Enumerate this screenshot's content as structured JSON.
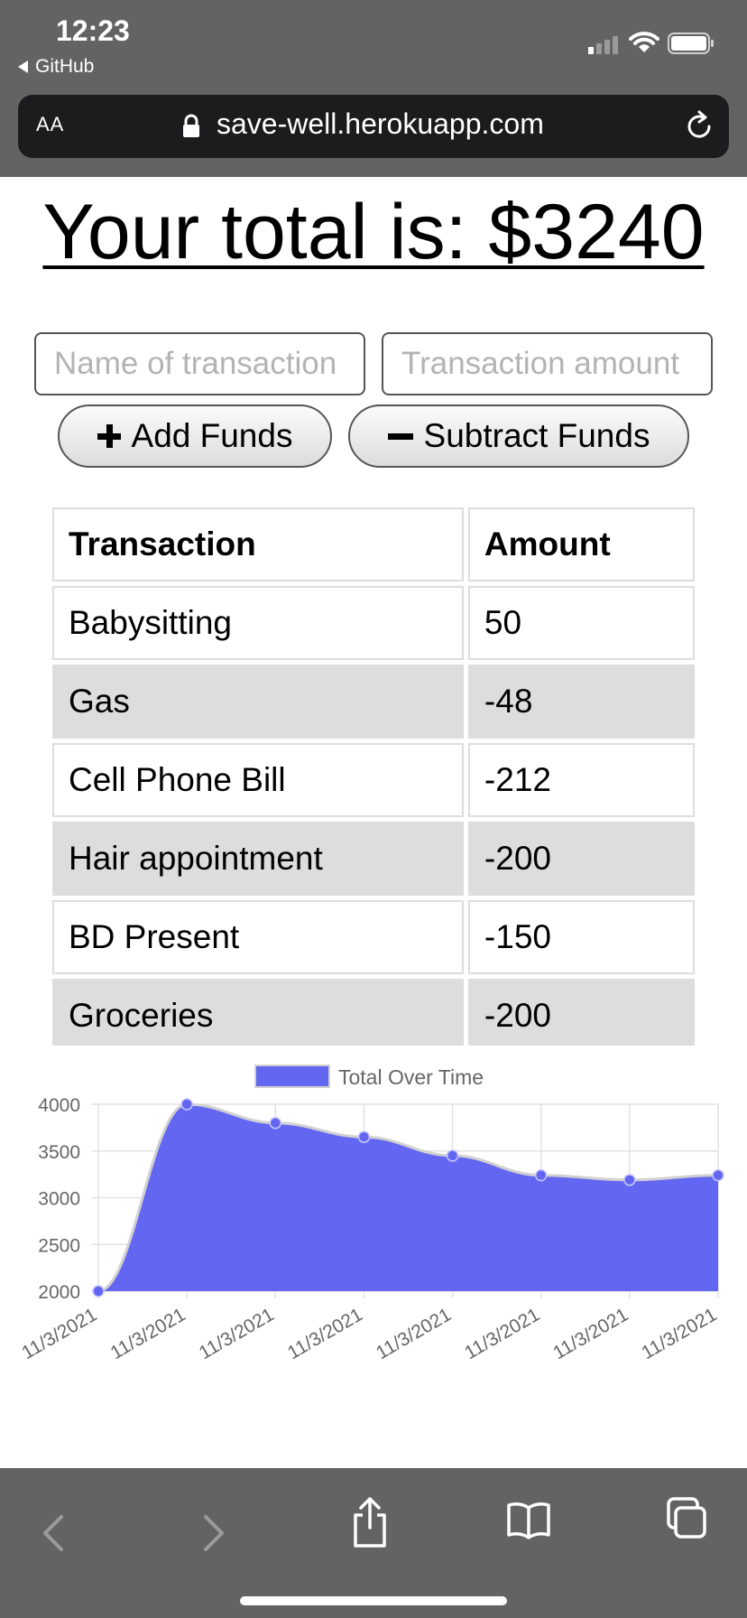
{
  "status_bar": {
    "time": "12:23",
    "back_app": "GitHub"
  },
  "browser": {
    "aa": "AA",
    "url": "save-well.herokuapp.com"
  },
  "page": {
    "total_text": "Your total is: $3240"
  },
  "form": {
    "name_placeholder": "Name of transaction",
    "amount_placeholder": "Transaction amount",
    "add_label": "Add Funds",
    "subtract_label": "Subtract Funds"
  },
  "table": {
    "headers": [
      "Transaction",
      "Amount"
    ],
    "rows": [
      {
        "name": "Babysitting",
        "amount": "50"
      },
      {
        "name": "Gas",
        "amount": "-48"
      },
      {
        "name": "Cell Phone Bill",
        "amount": "-212"
      },
      {
        "name": "Hair appointment",
        "amount": "-200"
      },
      {
        "name": "BD Present",
        "amount": "-150"
      },
      {
        "name": "Groceries",
        "amount": "-200"
      }
    ]
  },
  "chart_data": {
    "type": "area",
    "x": [
      "11/3/2021",
      "11/3/2021",
      "11/3/2021",
      "11/3/2021",
      "11/3/2021",
      "11/3/2021",
      "11/3/2021",
      "11/3/2021"
    ],
    "series": [
      {
        "name": "Total Over Time",
        "values": [
          2000,
          4000,
          3800,
          3650,
          3450,
          3240,
          3190,
          3240
        ]
      }
    ],
    "y_ticks": [
      "4000",
      "3500",
      "3000",
      "2500",
      "2000"
    ],
    "ylim": [
      2000,
      4000
    ],
    "grid": true,
    "legend": "top",
    "fill_color": "#6366f1",
    "line_color": "#d0d0d0"
  }
}
